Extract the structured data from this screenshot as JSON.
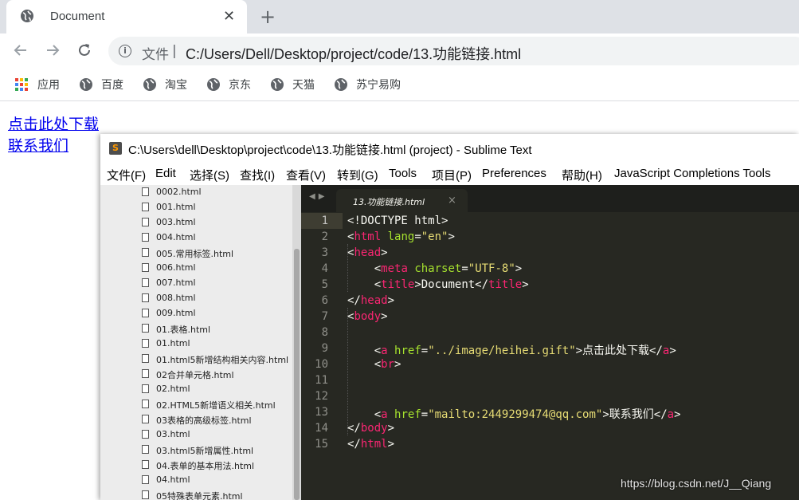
{
  "browser": {
    "tab_title": "Document",
    "tab_close": "✕",
    "new_tab": "+",
    "address_scheme": "文件",
    "address_sep": "|",
    "address_url": "C:/Users/Dell/Desktop/project/code/13.功能链接.html"
  },
  "bookmarks": [
    {
      "label": "应用"
    },
    {
      "label": "百度"
    },
    {
      "label": "淘宝"
    },
    {
      "label": "京东"
    },
    {
      "label": "天猫"
    },
    {
      "label": "苏宁易购"
    }
  ],
  "page": {
    "link1": "点击此处下载",
    "link2": "联系我们"
  },
  "sublime": {
    "title": "C:\\Users\\dell\\Desktop\\project\\code\\13.功能链接.html (project) - Sublime Text",
    "logo": "S",
    "menu": [
      "文件(F)",
      "Edit",
      "选择(S)",
      "查找(I)",
      "查看(V)",
      "转到(G)",
      "Tools",
      "项目(P)",
      "Preferences",
      "帮助(H)",
      "JavaScript Completions Tools"
    ],
    "files": [
      "0002.html",
      "001.html",
      "003.html",
      "004.html",
      "005.常用标签.html",
      "006.html",
      "007.html",
      "008.html",
      "009.html",
      "01.表格.html",
      "01.html",
      "01.html5新增结构相关内容.html",
      "02合并单元格.html",
      "02.html",
      "02.HTML5新增语义相关.html",
      "03表格的高级标签.html",
      "03.html",
      "03.html5新增属性.html",
      "04.表单的基本用法.html",
      "04.html",
      "05特殊表单元素.html"
    ],
    "tab_name": "13.功能链接.html",
    "tab_close": "×",
    "line_numbers": [
      "1",
      "2",
      "3",
      "4",
      "5",
      "6",
      "7",
      "8",
      "9",
      "10",
      "11",
      "12",
      "13",
      "14",
      "15"
    ]
  },
  "code": {
    "l1": "<!DOCTYPE html>",
    "l2_open": "<",
    "l2_tag": "html",
    "l2_attr": "lang",
    "l2_eq": "=",
    "l2_val": "\"en\"",
    "l2_close": ">",
    "l3_open": "<",
    "l3_tag": "head",
    "l3_close": ">",
    "l4_indent": "    <",
    "l4_tag": "meta",
    "l4_attr": "charset",
    "l4_eq": "=",
    "l4_val": "\"UTF-8\"",
    "l4_close": ">",
    "l5_indent": "    <",
    "l5_tag": "title",
    "l5_mid": ">Document</",
    "l5_tag2": "title",
    "l5_close": ">",
    "l6_open": "</",
    "l6_tag": "head",
    "l6_close": ">",
    "l7_open": "<",
    "l7_tag": "body",
    "l7_close": ">",
    "l9_indent": "    <",
    "l9_tag": "a",
    "l9_attr": "href",
    "l9_eq": "=",
    "l9_val": "\"../image/heihei.gift\"",
    "l9_mid": ">点击此处下载</",
    "l9_tag2": "a",
    "l9_close": ">",
    "l10_indent": "    <",
    "l10_tag": "br",
    "l10_close": ">",
    "l13_indent": "    <",
    "l13_tag": "a",
    "l13_attr": "href",
    "l13_eq": "=",
    "l13_val": "\"mailto:2449299474@qq.com\"",
    "l13_mid": ">联系我们</",
    "l13_tag2": "a",
    "l13_close": ">",
    "l14_open": "</",
    "l14_tag": "body",
    "l14_close": ">",
    "l15_open": "</",
    "l15_tag": "html",
    "l15_close": ">"
  },
  "watermark": "https://blog.csdn.net/J__Qiang",
  "colors": {
    "tag": "#f92672",
    "attr": "#a6e22e",
    "string": "#e6db74",
    "editor_bg": "#272822"
  }
}
